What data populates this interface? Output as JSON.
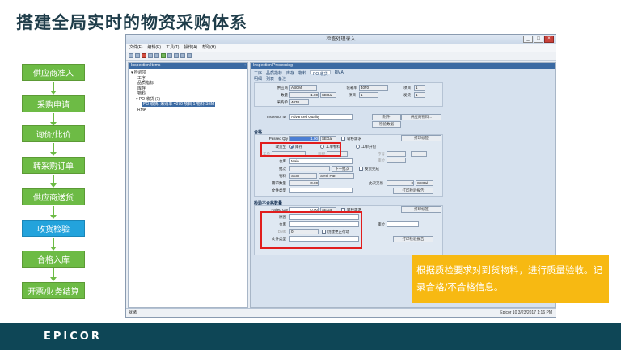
{
  "slide": {
    "title": "搭建全局实时的物资采购体系",
    "callout": "根据质检要求对到货物料，进行质量验收。记录合格/不合格信息。",
    "logo": "EPICOR"
  },
  "steps": [
    {
      "label": "供应商准入",
      "active": false
    },
    {
      "label": "采购申请",
      "active": false
    },
    {
      "label": "询价/比价",
      "active": false
    },
    {
      "label": "转采购订单",
      "active": false
    },
    {
      "label": "供应商送货",
      "active": false
    },
    {
      "label": "收货检验",
      "active": true
    },
    {
      "label": "合格入库",
      "active": false
    },
    {
      "label": "开票/财务结算",
      "active": false
    }
  ],
  "colors": {
    "step_green": "#6dbb45",
    "step_active": "#23a3dc",
    "callout": "#f7b912",
    "footer": "#0e4656",
    "highlight": "#e11d1d"
  },
  "window": {
    "title": "检查处理录入",
    "menu": [
      "文件(F)",
      "编辑(E)",
      "工具(T)",
      "操作(A)",
      "帮助(H)"
    ],
    "left_panel_header": "Inspection Items",
    "tree": [
      "检验项",
      "工序",
      "品质指标",
      "库存",
      "物料",
      "PO 收货 (1)",
      "PO 收货: 采购单 4070 项目 1 物料 SEM",
      "RMA"
    ],
    "right_panel_header": "Inspection Processing",
    "tabs_top": [
      "工序",
      "品质指标",
      "库存",
      "物料",
      "PO 收货",
      "RMA"
    ],
    "tabs_sub": [
      "明细",
      "列表",
      "备注"
    ],
    "form": {
      "supplier_label": "供应商",
      "supplier": "ABCM",
      "packslip_label": "装箱单",
      "packslip": "4070",
      "item_label": "项目",
      "item": "1",
      "qty_label": "数量",
      "qty": "1.00",
      "qty_uom": "SEGal",
      "line_label": "项目",
      "line": "1",
      "release_label": "发货",
      "release": "1",
      "po_label": "采购单",
      "po": "4070",
      "inspector_label": "Inspector ID",
      "inspector": "Advanced Quality",
      "attach_btn": "附件",
      "supplier_part_btn": "供应商物料...",
      "inspect_data_btn": "检验数据",
      "pass_section": "合格",
      "passed_qty_label": "Passed Qty",
      "passed_qty": "1.00",
      "passed_uom": "SEGal",
      "transfer_label": "转移需求",
      "print_tag_btn": "打印标签",
      "receive_to_label": "收货至",
      "stock_label": "库存",
      "job_mat_label": "工单物料",
      "job_asm_label": "工单升包",
      "job_label": "工单",
      "asm_label": "装配",
      "seq_label": "序号",
      "bin_label": "库位",
      "whse_label": "仓库",
      "whse": "Main",
      "lot_label": "批次",
      "next_lot_btn": "下一批次",
      "ship_complete_label": "发货完成",
      "part_label": "物料",
      "part": "SEM",
      "part_desc": "Semi Part",
      "req_qty_label": "需求数量",
      "req_qty": "0.00",
      "our_qty_label": "此次交易",
      "our_qty": "0",
      "our_uom": "SEGal",
      "doc_type_label": "文件类型",
      "print_report_btn": "打印检验报告",
      "fail_section": "检验不合格数量",
      "failed_qty_label": "Failed Qty",
      "failed_qty": "0.00",
      "failed_uom": "SEGal",
      "transfer_fail_label": "转移需求",
      "print_fail_btn": "打印标签",
      "reason_label": "原因",
      "fail_whse_label": "仓库",
      "fail_bin_label": "库位",
      "dmr_label": "DMR",
      "dmr": "0",
      "corrective_label": "创建更正行动",
      "fail_doc_label": "文件类型",
      "fail_report_btn": "打印检验报告"
    },
    "status_left": "就绪",
    "status_right": "Epicor 10   3/23/2017   1:16 PM"
  }
}
